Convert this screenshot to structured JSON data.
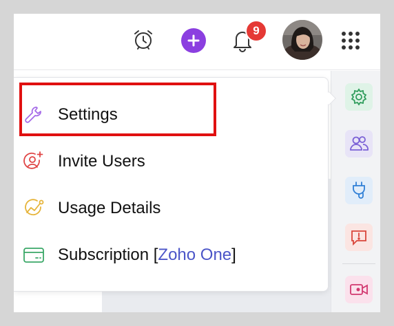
{
  "topbar": {
    "notification_count": "9"
  },
  "menu": {
    "items": [
      {
        "label": "Settings",
        "icon": "wrench-icon"
      },
      {
        "label": "Invite Users",
        "icon": "invite-user-icon"
      },
      {
        "label": "Usage Details",
        "icon": "usage-chart-icon"
      },
      {
        "label_prefix": "Subscription [",
        "label_link": "Zoho One",
        "label_suffix": "]",
        "icon": "card-icon"
      }
    ]
  },
  "right_rail": {
    "items": [
      "gear-icon",
      "users-icon",
      "plug-icon",
      "alert-icon",
      "video-icon"
    ]
  },
  "colors": {
    "accent_purple": "#8b3fe0",
    "badge_red": "#e53935",
    "highlight_red": "#e01010",
    "link_blue": "#4b55c8"
  }
}
